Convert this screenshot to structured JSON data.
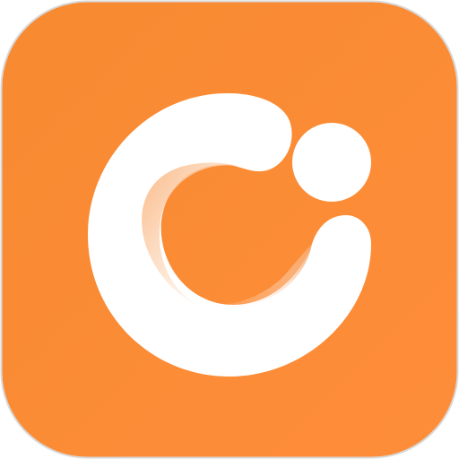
{
  "icon": {
    "name": "app-logo",
    "glyph": "c-ring-with-dot",
    "colors": {
      "background_top_left": "#f78a31",
      "background_bottom_right": "#ff8d3a",
      "border": "#d9d9d9",
      "glyph": "#ffffff",
      "inner_shadow": "#f9b27a"
    }
  }
}
